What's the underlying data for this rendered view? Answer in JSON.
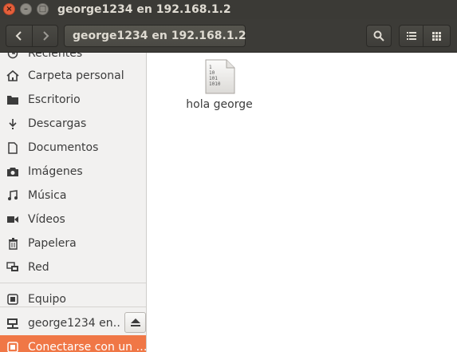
{
  "window": {
    "title": "george1234 en 192.168.1.2",
    "close_glyph": "×",
    "min_glyph": "–",
    "max_glyph": "□"
  },
  "toolbar": {
    "back_icon": "chevron-left-icon",
    "forward_icon": "chevron-right-icon",
    "path_label": "george1234 en 192.168.1.2",
    "search_icon": "search-icon",
    "list_icon": "list-view-icon",
    "grid_icon": "grid-view-icon"
  },
  "sidebar": {
    "items": [
      {
        "label": "Recientes",
        "icon": "clock-icon"
      },
      {
        "label": "Carpeta personal",
        "icon": "home-icon"
      },
      {
        "label": "Escritorio",
        "icon": "folder-icon"
      },
      {
        "label": "Descargas",
        "icon": "download-icon"
      },
      {
        "label": "Documentos",
        "icon": "document-icon"
      },
      {
        "label": "Imágenes",
        "icon": "camera-icon"
      },
      {
        "label": "Música",
        "icon": "music-icon"
      },
      {
        "label": "Vídeos",
        "icon": "video-icon"
      },
      {
        "label": "Papelera",
        "icon": "trash-icon"
      },
      {
        "label": "Red",
        "icon": "network-icon"
      },
      {
        "label": "Equipo",
        "icon": "computer-icon"
      },
      {
        "label": "george1234 en…",
        "icon": "network-share-icon"
      },
      {
        "label": "Conectarse con un …",
        "icon": "connect-server-icon"
      }
    ],
    "eject_icon": "eject-icon"
  },
  "files": [
    {
      "name": "hola george",
      "icon_text": [
        "1",
        "10",
        "101",
        "1010"
      ]
    }
  ],
  "colors": {
    "titlebar": "#3b3a36",
    "toolbar": "#3c3b37",
    "sidebar_bg": "#f2f1f0",
    "selection": "#f07746",
    "close_button": "#e5603b"
  }
}
